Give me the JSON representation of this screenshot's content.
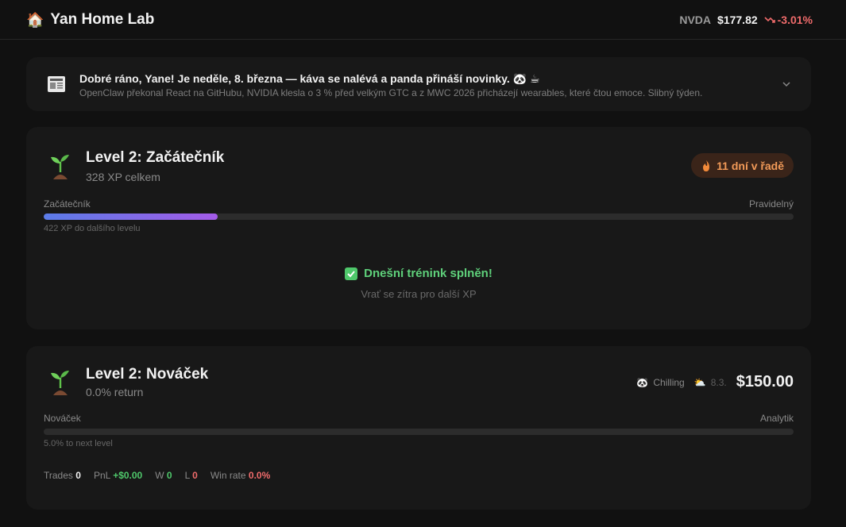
{
  "header": {
    "brand_icon": "house-emoji-icon",
    "title": "Yan Home Lab",
    "ticker": {
      "symbol": "NVDA",
      "price": "$177.82",
      "change": "-3.01%",
      "trend_icon": "trend-down-icon"
    }
  },
  "news": {
    "title": "Dobré ráno, Yane! Je neděle, 8. března — káva se nalévá a panda přináší novinky. 🐼 ☕",
    "summary": "OpenClaw překonal React na GitHubu, NVIDIA klesla o 3 % před velkým GTC a z MWC 2026 přicházejí wearables, které čtou emoce. Slibný týden."
  },
  "training": {
    "level_title": "Level 2: Začátečník",
    "xp_total": "328 XP celkem",
    "streak": "11 dní v řadě",
    "bar_left": "Začátečník",
    "bar_right": "Pravidelný",
    "progress": 0.232,
    "next_note": "422 XP do dalšího levelu",
    "done_text": "Dnešní trénink splněn!",
    "done_sub": "Vrať se zítra pro další XP"
  },
  "trading": {
    "level_title": "Level 2: Nováček",
    "return": "0.0% return",
    "mood": "Chilling",
    "date": "8.3.",
    "balance": "$150.00",
    "bar_left": "Nováček",
    "bar_right": "Analytik",
    "progress": 0.0,
    "next_note": "5.0% to next level",
    "stats": {
      "trades_label": "Trades",
      "trades": "0",
      "pnl_label": "PnL",
      "pnl": "+$0.00",
      "w_label": "W",
      "w": "0",
      "l_label": "L",
      "l": "0",
      "winrate_label": "Win rate",
      "winrate": "0.0%"
    }
  },
  "colors": {
    "accent_green": "#4fc86b",
    "accent_red": "#ef6b6b",
    "streak_orange": "#f29a58"
  }
}
